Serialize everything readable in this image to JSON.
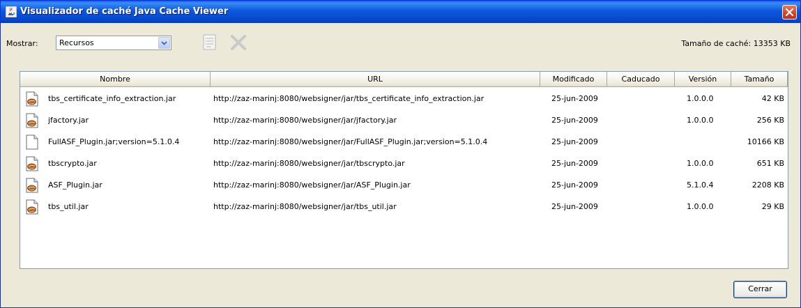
{
  "window": {
    "title": "Visualizador de caché Java Cache Viewer",
    "title_icon": "java-coffee-icon",
    "close_icon": "close-icon"
  },
  "toolbar": {
    "show_label": "Mostrar:",
    "show_value": "Recursos",
    "properties_icon": "properties-icon",
    "delete_icon": "delete-icon",
    "cache_size": "Tamaño de caché: 13353 KB"
  },
  "table": {
    "columns": [
      "Nombre",
      "URL",
      "Modificado",
      "Caducado",
      "Versión",
      "Tamaño"
    ],
    "rows": [
      {
        "name": "tbs_certificate_info_extraction.jar",
        "url": "http://zaz-marinj:8080/websigner/jar/tbs_certificate_info_extraction.jar",
        "modified": "25-jun-2009",
        "expires": "",
        "version": "1.0.0.0",
        "size": "42 KB",
        "icon": "jar-file-icon"
      },
      {
        "name": "jfactory.jar",
        "url": "http://zaz-marinj:8080/websigner/jar/jfactory.jar",
        "modified": "25-jun-2009",
        "expires": "",
        "version": "1.0.0.0",
        "size": "256 KB",
        "icon": "jar-file-icon"
      },
      {
        "name": "FullASF_Plugin.jar;version=5.1.0.4",
        "url": "http://zaz-marinj:8080/websigner/jar/FullASF_Plugin.jar;version=5.1.0.4",
        "modified": "25-jun-2009",
        "expires": "",
        "version": "",
        "size": "10166 KB",
        "icon": "blank-file-icon"
      },
      {
        "name": "tbscrypto.jar",
        "url": "http://zaz-marinj:8080/websigner/jar/tbscrypto.jar",
        "modified": "25-jun-2009",
        "expires": "",
        "version": "1.0.0.0",
        "size": "651 KB",
        "icon": "jar-file-icon"
      },
      {
        "name": "ASF_Plugin.jar",
        "url": "http://zaz-marinj:8080/websigner/jar/ASF_Plugin.jar",
        "modified": "25-jun-2009",
        "expires": "",
        "version": "5.1.0.4",
        "size": "2208 KB",
        "icon": "jar-file-icon"
      },
      {
        "name": "tbs_util.jar",
        "url": "http://zaz-marinj:8080/websigner/jar/tbs_util.jar",
        "modified": "25-jun-2009",
        "expires": "",
        "version": "1.0.0.0",
        "size": "29 KB",
        "icon": "jar-file-icon"
      }
    ]
  },
  "footer": {
    "close_label": "Cerrar"
  },
  "colors": {
    "titlebar": "#0b58de",
    "close_button": "#d1422a",
    "dialog_bg": "#ece9d8"
  }
}
